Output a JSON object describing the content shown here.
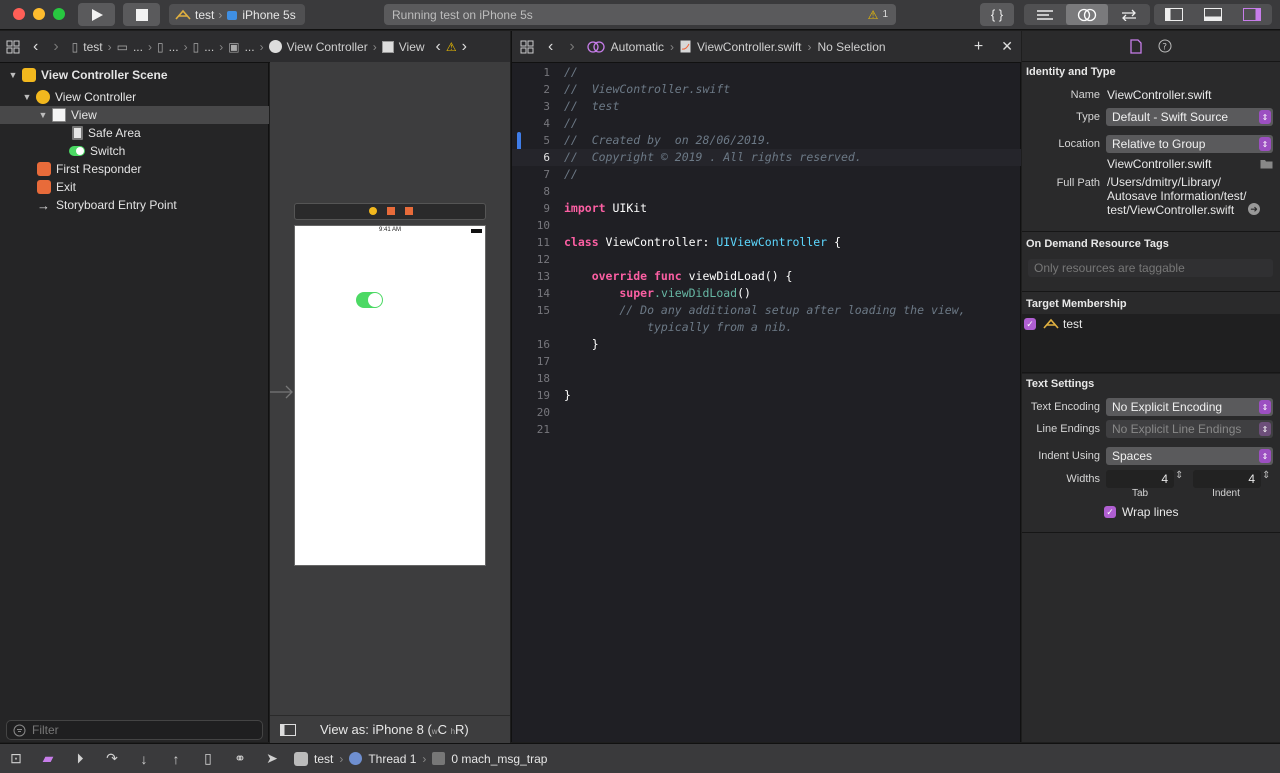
{
  "toolbar": {
    "scheme_target": "test",
    "device": "iPhone 5s",
    "activity_text": "Running test on iPhone 5s",
    "warning_count": "1",
    "library_label": "{ }"
  },
  "navigator": {
    "jumpbar": {
      "project": "test",
      "ellipsis1": "...",
      "ellipsis2": "...",
      "ellipsis3": "...",
      "scene": "View Controller",
      "view": "View"
    },
    "tree": [
      {
        "label": "View Controller Scene",
        "icon": "scene-icon"
      },
      {
        "label": "View Controller",
        "icon": "view-controller-icon"
      },
      {
        "label": "View",
        "icon": "view-icon"
      },
      {
        "label": "Safe Area",
        "icon": "safe-area-icon"
      },
      {
        "label": "Switch",
        "icon": "switch-icon"
      },
      {
        "label": "First Responder",
        "icon": "first-responder-icon"
      },
      {
        "label": "Exit",
        "icon": "exit-icon"
      },
      {
        "label": "Storyboard Entry Point",
        "icon": "arrow-right-icon"
      }
    ],
    "filter_placeholder": "Filter"
  },
  "canvas": {
    "status_time": "9:41 AM",
    "view_as": "View as: iPhone 8 (",
    "view_as_w": "w",
    "view_as_c": "C ",
    "view_as_h": "h",
    "view_as_r": "R)"
  },
  "editor": {
    "jumpbar": {
      "mode": "Automatic",
      "file": "ViewController.swift",
      "selection": "No Selection"
    },
    "lines": [
      {
        "n": "1",
        "t": "//"
      },
      {
        "n": "2",
        "t": "//  ViewController.swift"
      },
      {
        "n": "3",
        "t": "//  test"
      },
      {
        "n": "4",
        "t": "//"
      },
      {
        "n": "5",
        "t": "//  Created by  on 28/06/2019."
      },
      {
        "n": "6",
        "t": "//  Copyright © 2019 . All rights reserved."
      },
      {
        "n": "7",
        "t": "//"
      },
      {
        "n": "8",
        "t": ""
      },
      {
        "n": "9",
        "kw": "import",
        "rest": " UIKit"
      },
      {
        "n": "10",
        "t": ""
      },
      {
        "n": "11",
        "kw": "class",
        "mid": " ViewController: ",
        "type": "UIViewController",
        "rest": " {"
      },
      {
        "n": "12",
        "t": ""
      },
      {
        "n": "13",
        "kw": "    override func",
        "rest": " viewDidLoad() {"
      },
      {
        "n": "14",
        "kw2": "        super",
        "fn": ".viewDidLoad",
        "rest": "()"
      },
      {
        "n": "15",
        "t": "        // Do any additional setup after loading the view,"
      },
      {
        "n": "",
        "t": "            typically from a nib."
      },
      {
        "n": "16",
        "rest": "    }"
      },
      {
        "n": "17",
        "t": ""
      },
      {
        "n": "18",
        "t": ""
      },
      {
        "n": "19",
        "rest": "}"
      },
      {
        "n": "20",
        "t": ""
      },
      {
        "n": "21",
        "t": ""
      }
    ]
  },
  "inspector": {
    "identity_title": "Identity and Type",
    "name_label": "Name",
    "name_value": "ViewController.swift",
    "type_label": "Type",
    "type_value": "Default - Swift Source",
    "location_label": "Location",
    "location_value": "Relative to Group",
    "location_file": "ViewController.swift",
    "full_path_label": "Full Path",
    "full_path_1": "/Users/dmitry/Library/",
    "full_path_2": "Autosave Information/test/",
    "full_path_3": "test/ViewController.swift",
    "odr_title": "On Demand Resource Tags",
    "odr_placeholder": "Only resources are taggable",
    "target_title": "Target Membership",
    "target_name": "test",
    "text_settings_title": "Text Settings",
    "encoding_label": "Text Encoding",
    "encoding_value": "No Explicit Encoding",
    "line_endings_label": "Line Endings",
    "line_endings_value": "No Explicit Line Endings",
    "indent_using_label": "Indent Using",
    "indent_using_value": "Spaces",
    "widths_label": "Widths",
    "tab_value": "4",
    "indent_value": "4",
    "tab_label": "Tab",
    "indent_label": "Indent",
    "wrap_label": "Wrap lines"
  },
  "debug": {
    "target": "test",
    "thread": "Thread 1",
    "frame": "0 mach_msg_trap"
  },
  "colors": {
    "accent_purple": "#b05fd2",
    "switch_green": "#4cd964",
    "keyword_pink": "#fc5fa3",
    "type_cyan": "#5dd8ff"
  }
}
